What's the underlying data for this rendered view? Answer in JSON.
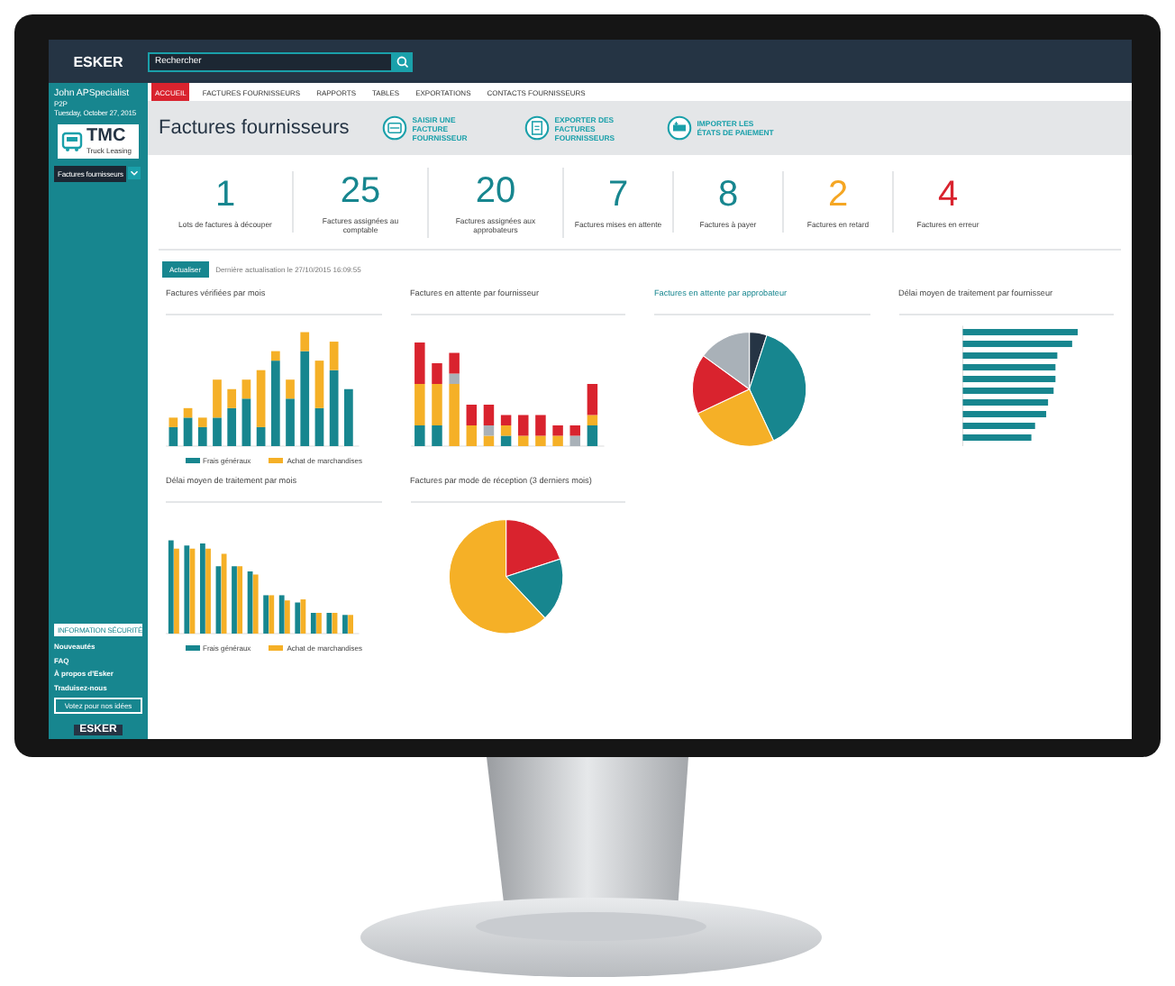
{
  "brand": {
    "logo": "ESKER"
  },
  "search": {
    "placeholder": "Rechercher"
  },
  "user": {
    "name": "John APSpecialist",
    "role": "P2P",
    "date": "Tuesday, October 27, 2015"
  },
  "company_logo": {
    "text": "TMC",
    "subtitle": "Truck Leasing"
  },
  "sidebar_menu": {
    "label": "Factures fournisseurs"
  },
  "security_button": "INFORMATION SÉCURITÉ",
  "sidebar_links": [
    "Nouveautés",
    "FAQ",
    "À propos d'Esker",
    "Traduisez-nous"
  ],
  "vote_button": "Votez pour nos idées",
  "footer_logo": "ESKER",
  "tabs": [
    {
      "label": "ACCUEIL",
      "selected": true
    },
    {
      "label": "FACTURES FOURNISSEURS",
      "selected": false
    },
    {
      "label": "RAPPORTS",
      "selected": false
    },
    {
      "label": "TABLES",
      "selected": false
    },
    {
      "label": "EXPORTATIONS",
      "selected": false
    },
    {
      "label": "CONTACTS FOURNISSEURS",
      "selected": false
    }
  ],
  "page_title": "Factures fournisseurs",
  "actions": [
    {
      "label": "SAISIR UNE FACTURE FOURNISSEUR",
      "kind": "entry"
    },
    {
      "label": "EXPORTER DES FACTURES FOURNISSEURS",
      "kind": "export"
    },
    {
      "label": "IMPORTER LES ÉTATS DE PAIEMENT",
      "kind": "import"
    }
  ],
  "kpis": [
    {
      "value": "1",
      "label": "Lots de factures à découper",
      "color": "#17868f"
    },
    {
      "value": "25",
      "label": "Factures assignées au comptable",
      "color": "#17868f"
    },
    {
      "value": "20",
      "label": "Factures assignées aux approbateurs",
      "color": "#17868f"
    },
    {
      "value": "7",
      "label": "Factures mises en attente",
      "color": "#17868f"
    },
    {
      "value": "8",
      "label": "Factures à payer",
      "color": "#17868f"
    },
    {
      "value": "2",
      "label": "Factures en retard",
      "color": "#f5a623"
    },
    {
      "value": "4",
      "label": "Factures en erreur",
      "color": "#d9232e"
    }
  ],
  "refresh": {
    "button": "Actualiser",
    "last_update": "Dernière actualisation le 27/10/2015 16:09:55"
  },
  "charts": [
    {
      "title": "Factures vérifiées par mois",
      "kind": "stacked",
      "legend": [
        "Frais généraux",
        "Achat de marchandises"
      ]
    },
    {
      "title": "Factures en attente par fournisseur",
      "kind": "stacked3"
    },
    {
      "title": "Factures en attente par approbateur",
      "kind": "pie1"
    },
    {
      "title": "Délai moyen de traitement par fournisseur",
      "kind": "hbar"
    },
    {
      "title": "Délai moyen de traitement par mois",
      "kind": "grouped",
      "legend": [
        "Frais généraux",
        "Achat de marchandises"
      ]
    },
    {
      "title": "Factures par mode de réception (3 derniers mois)",
      "kind": "pie2"
    }
  ]
}
